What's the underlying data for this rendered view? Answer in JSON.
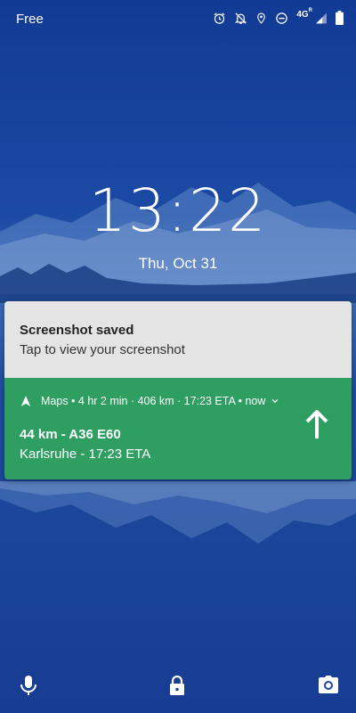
{
  "status_bar": {
    "carrier": "Free",
    "network": "4G",
    "network_sup": "R",
    "icons": [
      "alarm-icon",
      "notifications-off-icon",
      "location-icon",
      "do-not-disturb-icon",
      "signal-icon",
      "battery-icon"
    ]
  },
  "lockscreen": {
    "time": "13:22",
    "date": "Thu, Oct 31"
  },
  "notifications": {
    "screenshot": {
      "title": "Screenshot saved",
      "text": "Tap to view your screenshot"
    },
    "maps": {
      "header": "Maps • 4 hr 2 min · 406 km · 17:23 ETA • now",
      "distance_road": "44 km - A36 E60",
      "destination": "Karlsruhe - 17:23 ETA",
      "direction_icon": "arrow-up-icon",
      "background_color": "#2e9e61"
    }
  },
  "shortcuts": {
    "left": "mic-icon",
    "center": "lock-icon",
    "right": "camera-icon"
  }
}
